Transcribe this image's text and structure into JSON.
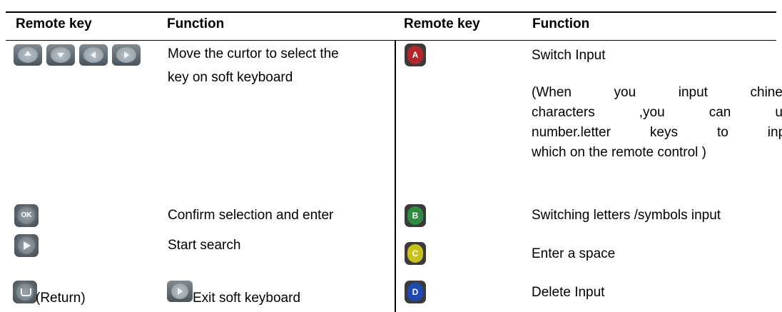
{
  "headers": {
    "remote_key_left": "Remote key",
    "function_left": "Function",
    "remote_key_right": "Remote key",
    "function_right": "Function"
  },
  "left_rows": [
    {
      "icon": "arrow-keys-icon",
      "function_lines": [
        "Move the curtor to select the",
        "key on soft keyboard"
      ]
    },
    {
      "icon": "ok-button-icon",
      "function": "Confirm selection and enter"
    },
    {
      "icon": "play-button-icon",
      "function": "Start search"
    },
    {
      "icon": "return-button-icon",
      "key_note": "(Return)",
      "icon2": "right-arrow-key-icon",
      "function": "Exit soft keyboard"
    }
  ],
  "right_rows": [
    {
      "icon": "red-a-button-icon",
      "button_letter": "A",
      "function": "Switch Input",
      "note_lines": [
        "(When you input chinese",
        "characters ,you can use",
        "number.letter keys to input",
        "which on the remote control )"
      ]
    },
    {
      "icon": "green-b-button-icon",
      "button_letter": "B",
      "function": "Switching letters /symbols input"
    },
    {
      "icon": "yellow-c-button-icon",
      "button_letter": "C",
      "function": "Enter a space"
    },
    {
      "icon": "blue-d-button-icon",
      "button_letter": "D",
      "function": "Delete Input"
    }
  ],
  "icon_glyphs": {
    "ok_label": "OK"
  },
  "colors": {
    "red": "#b3262b",
    "green": "#2e8b3f",
    "yellow": "#c9c21c",
    "blue": "#1f48b5"
  }
}
